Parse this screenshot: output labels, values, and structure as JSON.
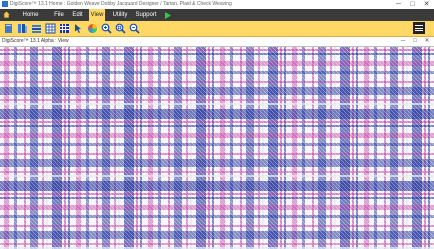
{
  "window": {
    "title": "DigiScore™ 13.1 Home : Golden Weave Dobby Jacquard Designer / Tartan, Plaid & Check Weaving",
    "minimize": "─",
    "maximize": "□",
    "close": "✕"
  },
  "menu": {
    "items": [
      "Home Screen",
      "File",
      "Edit",
      "View",
      "Utility",
      "Support"
    ],
    "active": "View"
  },
  "toolbar": {
    "icons": [
      "page-icon",
      "columns-icon",
      "layers-icon",
      "grid-icon",
      "weave-grid-icon",
      "pointer-icon",
      "color-wheel-icon",
      "zoom-in-icon",
      "zoom-fit-icon",
      "zoom-out-icon"
    ],
    "menu_icon": "hamburger-icon"
  },
  "subwindow": {
    "title": "DigiScore™ 13.1 Alpha : View"
  },
  "weave": {
    "colors": {
      "navy": "#1f2f9a",
      "magenta": "#c0359e",
      "white": "#f6f6fa",
      "light": "#e6e6ee"
    }
  }
}
